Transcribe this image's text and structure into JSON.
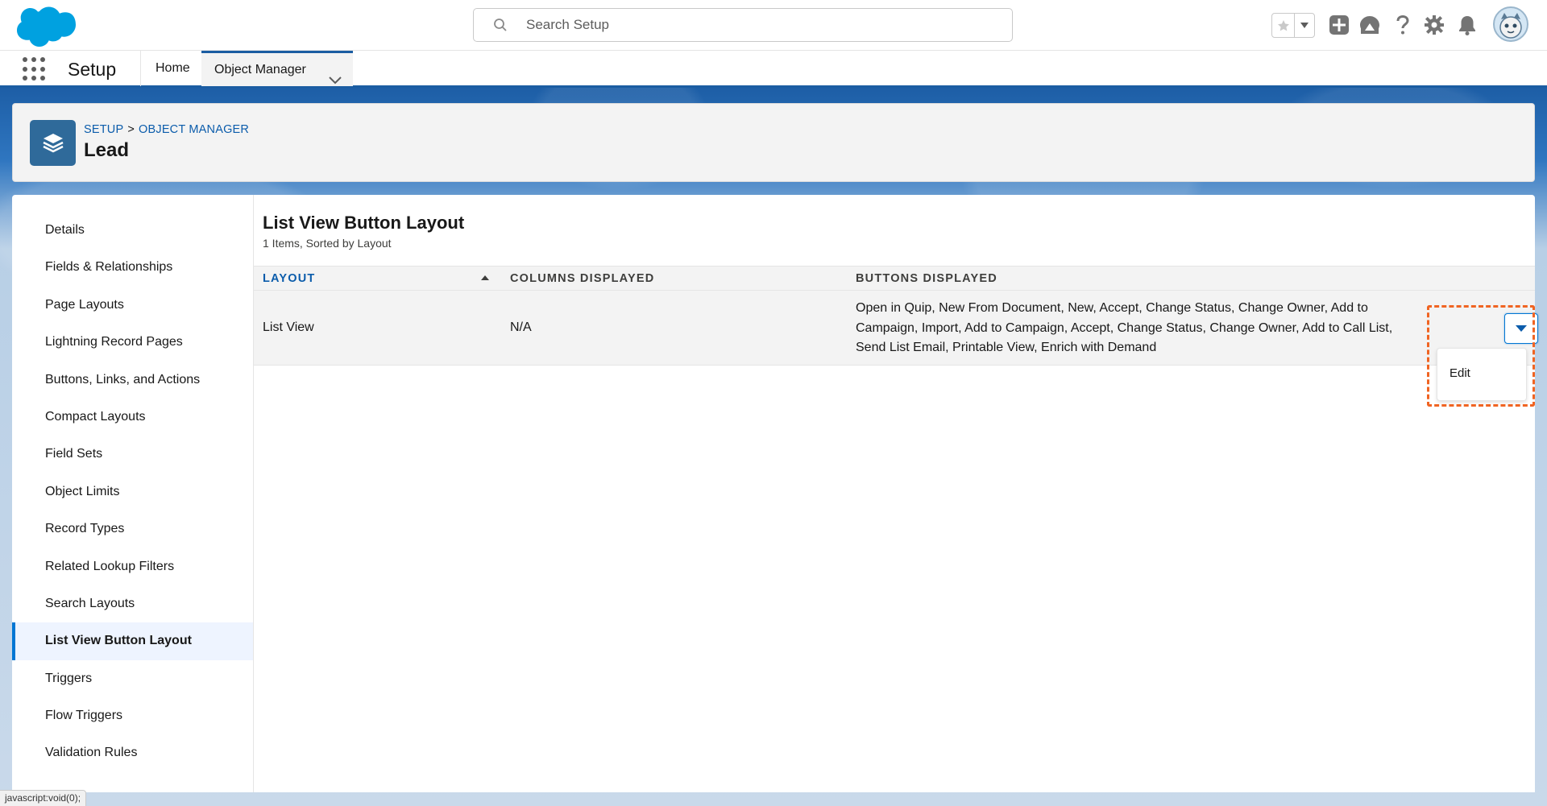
{
  "header": {
    "search_placeholder": "Search Setup",
    "icons": [
      "salesforce-logo",
      "star-icon",
      "chevron-down-icon",
      "add-icon",
      "trailhead-icon",
      "help-icon",
      "gear-icon",
      "bell-icon",
      "avatar"
    ]
  },
  "context_nav": {
    "app_name": "Setup",
    "tabs": [
      {
        "label": "Home"
      },
      {
        "label": "Object Manager"
      }
    ]
  },
  "page_header": {
    "breadcrumb": [
      "SETUP",
      "OBJECT MANAGER"
    ],
    "breadcrumb_sep": ">",
    "title": "Lead"
  },
  "sidebar": {
    "items": [
      {
        "label": "Details"
      },
      {
        "label": "Fields & Relationships"
      },
      {
        "label": "Page Layouts"
      },
      {
        "label": "Lightning Record Pages"
      },
      {
        "label": "Buttons, Links, and Actions"
      },
      {
        "label": "Compact Layouts"
      },
      {
        "label": "Field Sets"
      },
      {
        "label": "Object Limits"
      },
      {
        "label": "Record Types"
      },
      {
        "label": "Related Lookup Filters"
      },
      {
        "label": "Search Layouts"
      },
      {
        "label": "List View Button Layout"
      },
      {
        "label": "Triggers"
      },
      {
        "label": "Flow Triggers"
      },
      {
        "label": "Validation Rules"
      }
    ],
    "active": "List View Button Layout"
  },
  "content": {
    "title": "List View Button Layout",
    "subtitle": "1 Items, Sorted by Layout",
    "columns": [
      "LAYOUT",
      "COLUMNS DISPLAYED",
      "BUTTONS DISPLAYED"
    ],
    "rows": [
      {
        "layout": "List View",
        "columns_displayed": "N/A",
        "buttons_displayed": "Open in Quip, New From Document, New, Accept, Change Status, Change Owner, Add to Campaign, Import, Add to Campaign, Accept, Change Status, Change Owner, Add to Call List, Send List Email, Printable View, Enrich with Demand"
      }
    ],
    "row_menu": {
      "items": [
        "Edit"
      ]
    }
  },
  "status_bar": {
    "text": "javascript:void(0);"
  },
  "colors": {
    "brand_blue": "#0176d3",
    "header_blue": "#1e5fa3",
    "highlight": "#f06422"
  }
}
